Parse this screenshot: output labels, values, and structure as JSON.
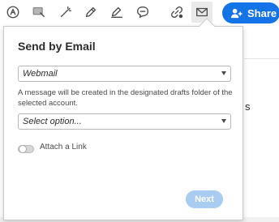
{
  "toolbar": {
    "icons": [
      "fill-sign-icon",
      "comment-icon",
      "highlight-wand-icon",
      "edit-pen-icon",
      "draw-signature-icon",
      "chat-bubble-icon",
      "link-icon",
      "email-icon"
    ],
    "share_label": "Share"
  },
  "background": {
    "partial_text": "s"
  },
  "popup": {
    "title": "Send by Email",
    "provider_select": {
      "value": "Webmail"
    },
    "description": "A message will be created in the designated drafts folder of the selected account.",
    "account_select": {
      "value": "Select option..."
    },
    "attach_link_label": "Attach a Link",
    "attach_link_on": false,
    "next_label": "Next"
  },
  "colors": {
    "accent": "#1473e6",
    "next_disabled": "#a8ccf2"
  }
}
